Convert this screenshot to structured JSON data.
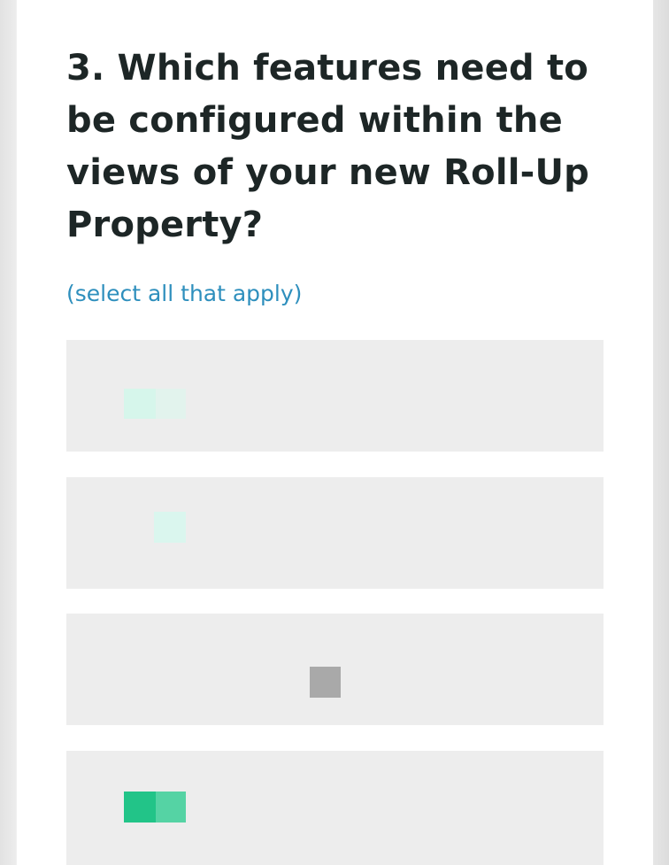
{
  "question": {
    "title": "3. Which features need to be configured within the views of your new Roll-Up Property?",
    "hint": "(select all that apply)"
  },
  "options": [
    {
      "label": ""
    },
    {
      "label": ""
    },
    {
      "label": ""
    },
    {
      "label": ""
    }
  ],
  "colors": {
    "title": "#1d2626",
    "hint": "#2e8fbd",
    "option_background": "#ededed",
    "accent_light": "#d8f6ec",
    "accent_strong": "#22c488",
    "accent_mid": "#55d3a4",
    "placeholder_gray": "#a9a9a9"
  }
}
